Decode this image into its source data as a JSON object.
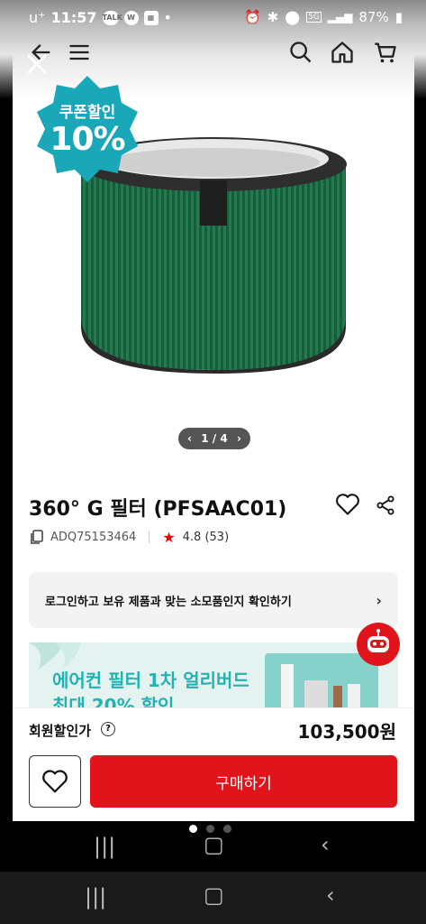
{
  "status_bar": {
    "time": "11:57",
    "carrier": "u⁺",
    "battery": "87%",
    "network": "5G"
  },
  "header": {
    "icons": [
      "back-arrow-icon",
      "menu-icon",
      "search-icon",
      "home-icon",
      "cart-icon",
      "close-icon"
    ]
  },
  "badge": {
    "line1": "쿠폰할인",
    "line2": "10%"
  },
  "gallery": {
    "pager_text": "1 / 4"
  },
  "product": {
    "title": "360° G 필터 (PFSAAC01)",
    "sku": "ADQ75153464",
    "rating": "4.8 (53)"
  },
  "login_prompt": {
    "text": "로그인하고 보유 제품과 맞는 소모품인지 확인하기"
  },
  "banner": {
    "line1": "에어컨 필터 1차 얼리버드",
    "line2": "최대 20% 할인"
  },
  "purchase": {
    "price_label": "회원할인가",
    "price": "103,500원",
    "buy_label": "구매하기"
  },
  "colors": {
    "accent": "#e1141c",
    "badge": "#1aa7b8",
    "filter_green": "#1f6b4a"
  }
}
